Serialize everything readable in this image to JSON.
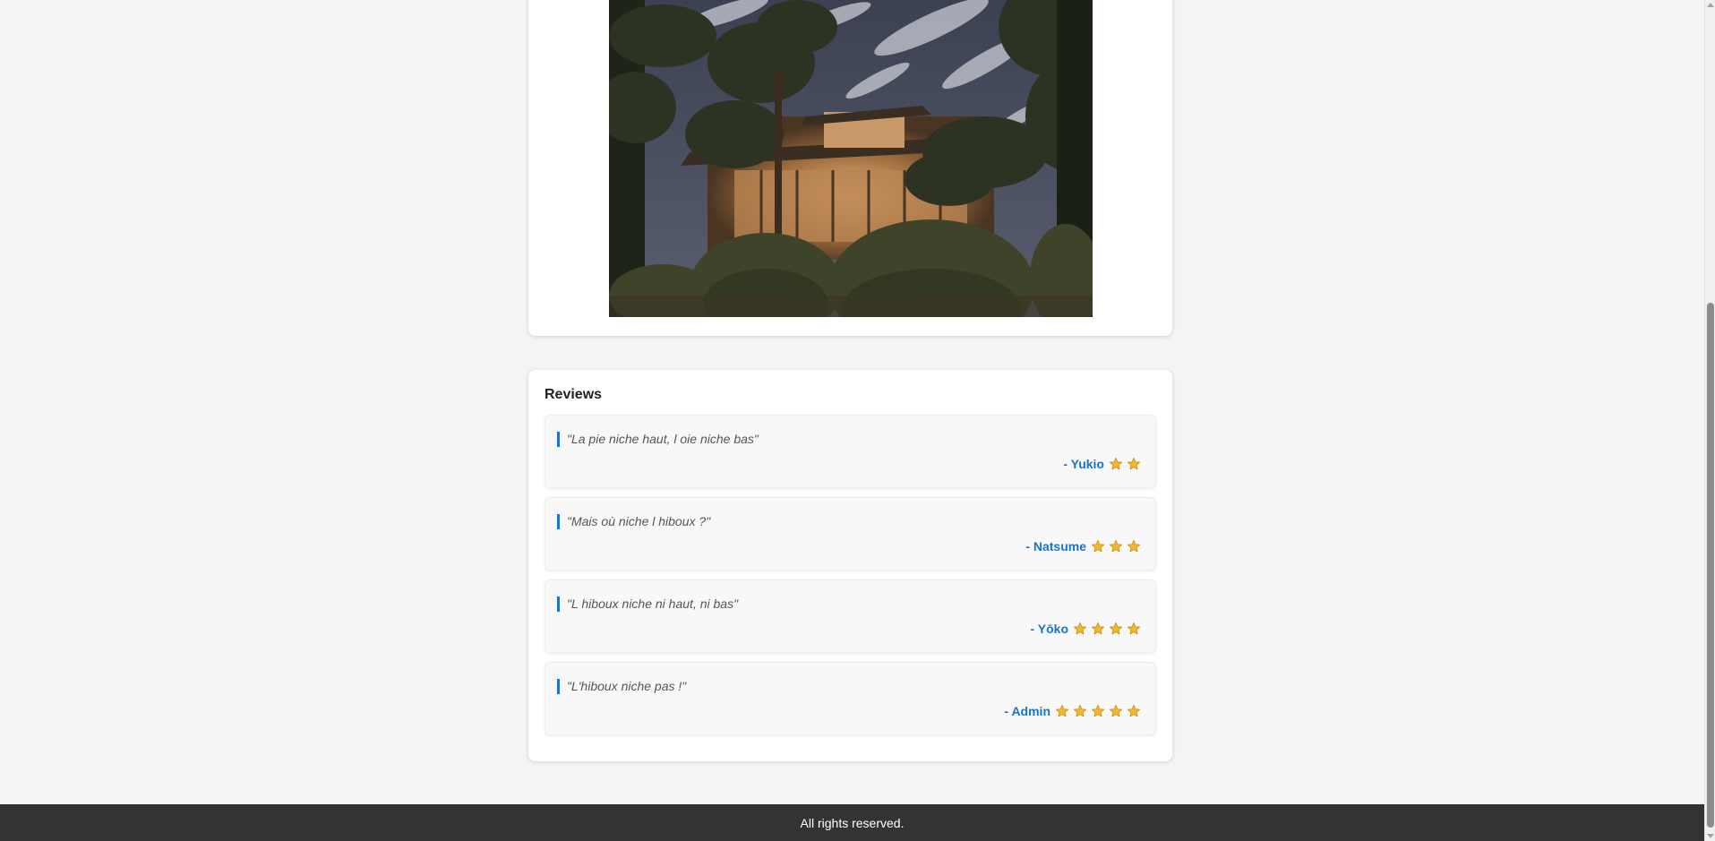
{
  "photo": {
    "alt": "Japanese house at night with pine trees and clipped shrubs"
  },
  "reviews": {
    "title": "Reviews",
    "items": [
      {
        "quote": "\"La pie niche haut, l oie niche bas\"",
        "author": "- Yukio",
        "stars": 2
      },
      {
        "quote": "\"Mais où niche l hiboux ?\"",
        "author": "- Natsume",
        "stars": 3
      },
      {
        "quote": "\"L hiboux niche ni haut, ni bas\"",
        "author": "- Yōko",
        "stars": 4
      },
      {
        "quote": "\"L'hiboux niche pas !\"",
        "author": "- Admin",
        "stars": 5
      }
    ]
  },
  "footer": {
    "text": "All rights reserved."
  },
  "colors": {
    "accent": "#1a73c7",
    "star": "#f2b632",
    "footer_bg": "#333333",
    "page_bg": "#f4f4f4"
  },
  "icons": {
    "star": "star-icon"
  }
}
